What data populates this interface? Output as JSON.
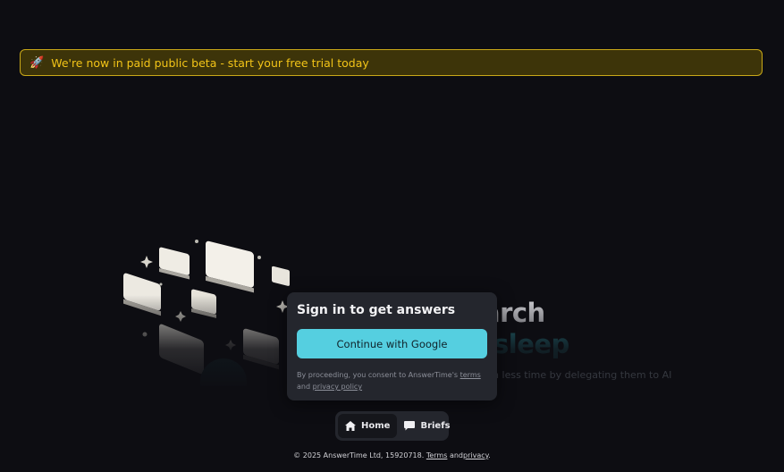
{
  "banner": {
    "text": "We're now in paid public beta - start your free trial today"
  },
  "hero": {
    "line1": "arch",
    "line2": "sleep",
    "subtitle": "in less time by delegating them to AI"
  },
  "modal": {
    "title": "Sign in to get answers",
    "google_button": "Continue with Google",
    "consent_prefix": "By proceeding, you consent to AnswerTime's",
    "terms_link": "terms",
    "consent_and": "and",
    "privacy_link": "privacy policy"
  },
  "nav": {
    "home": "Home",
    "briefs": "Briefs"
  },
  "footer": {
    "copyright": "© 2025 AnswerTime Ltd, 15920718.",
    "terms": "Terms",
    "and": "and",
    "privacy": "privacy",
    "period": "."
  },
  "colors": {
    "background": "#0d0d12",
    "banner_bg": "#3d3409",
    "banner_border": "#c9a818",
    "banner_text": "#f2c418",
    "accent": "#55cfe0",
    "modal_bg": "#24262d",
    "hero_accent": "#2b8d99"
  },
  "icons": {
    "banner": "rocket-icon",
    "home": "home-icon",
    "briefs": "chat-bubble-icon"
  }
}
